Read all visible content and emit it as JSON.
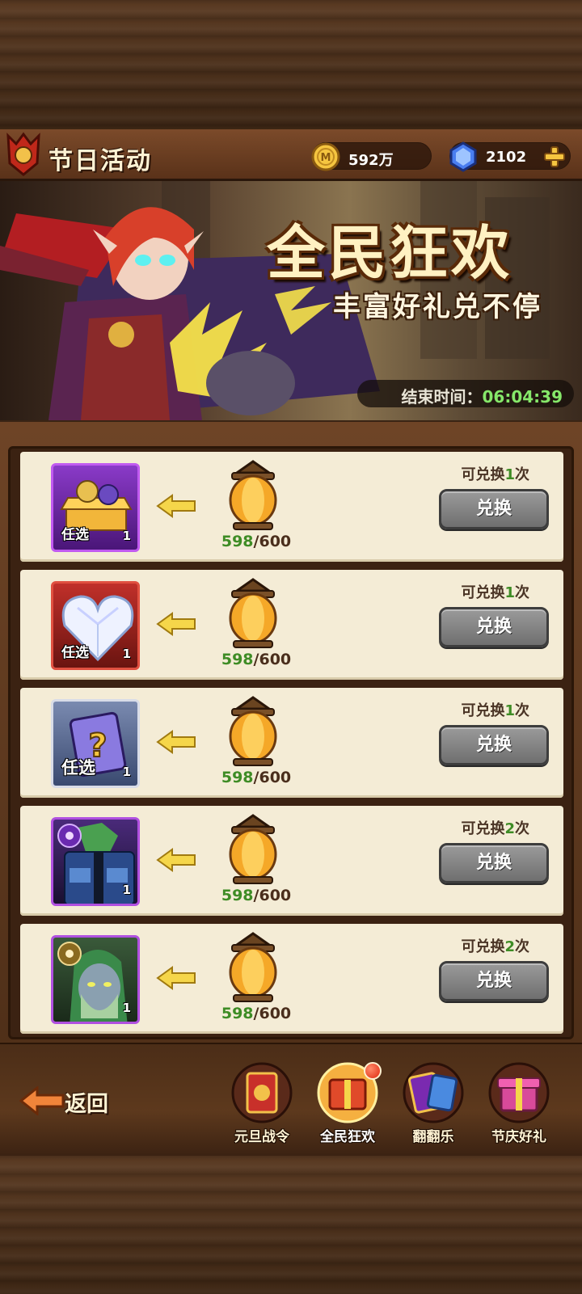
{
  "header": {
    "title": "节日活动",
    "gold": "592万",
    "gems": "2102"
  },
  "banner": {
    "title": "全民狂欢",
    "subtitle": "丰富好礼兑不停",
    "end_time_label": "结束时间：",
    "end_time_value": "06:04:39"
  },
  "items": [
    {
      "tag": "任选",
      "count": "1",
      "icon": "golden-chest-icon",
      "frame": "purple",
      "progress_current": "598",
      "progress_total": "/600",
      "limit_prefix": "可兑换",
      "limit_count": "1",
      "limit_suffix": "次",
      "button": "兑换"
    },
    {
      "tag": "任选",
      "count": "1",
      "icon": "crystal-heart-icon",
      "frame": "red",
      "progress_current": "598",
      "progress_total": "/600",
      "limit_prefix": "可兑换",
      "limit_count": "1",
      "limit_suffix": "次",
      "button": "兑换"
    },
    {
      "tag": "任选",
      "count": "1",
      "icon": "mystery-card-icon",
      "frame": "blue",
      "progress_current": "598",
      "progress_total": "/600",
      "limit_prefix": "可兑换",
      "limit_count": "1",
      "limit_suffix": "次",
      "button": "兑换"
    },
    {
      "tag": "",
      "count": "1",
      "icon": "armored-hero-portrait-icon",
      "frame": "purple",
      "progress_current": "598",
      "progress_total": "/600",
      "limit_prefix": "可兑换",
      "limit_count": "2",
      "limit_suffix": "次",
      "button": "兑换"
    },
    {
      "tag": "",
      "count": "1",
      "icon": "green-druid-portrait-icon",
      "frame": "purple",
      "progress_current": "598",
      "progress_total": "/600",
      "limit_prefix": "可兑换",
      "limit_count": "2",
      "limit_suffix": "次",
      "button": "兑换"
    }
  ],
  "nav": {
    "back_label": "返回",
    "tabs": [
      {
        "label": "元旦战令",
        "icon": "new-year-pass-icon"
      },
      {
        "label": "全民狂欢",
        "icon": "carnival-gift-icon",
        "active": true,
        "badge": true
      },
      {
        "label": "翻翻乐",
        "icon": "card-flip-icon"
      },
      {
        "label": "节庆好礼",
        "icon": "festival-gift-box-icon"
      }
    ]
  },
  "colors": {
    "progress_green": "#3e8c25",
    "button_gray": "#8a8a8a",
    "row_bg": "#f4ecd6",
    "wood_dark": "#3d2614"
  }
}
